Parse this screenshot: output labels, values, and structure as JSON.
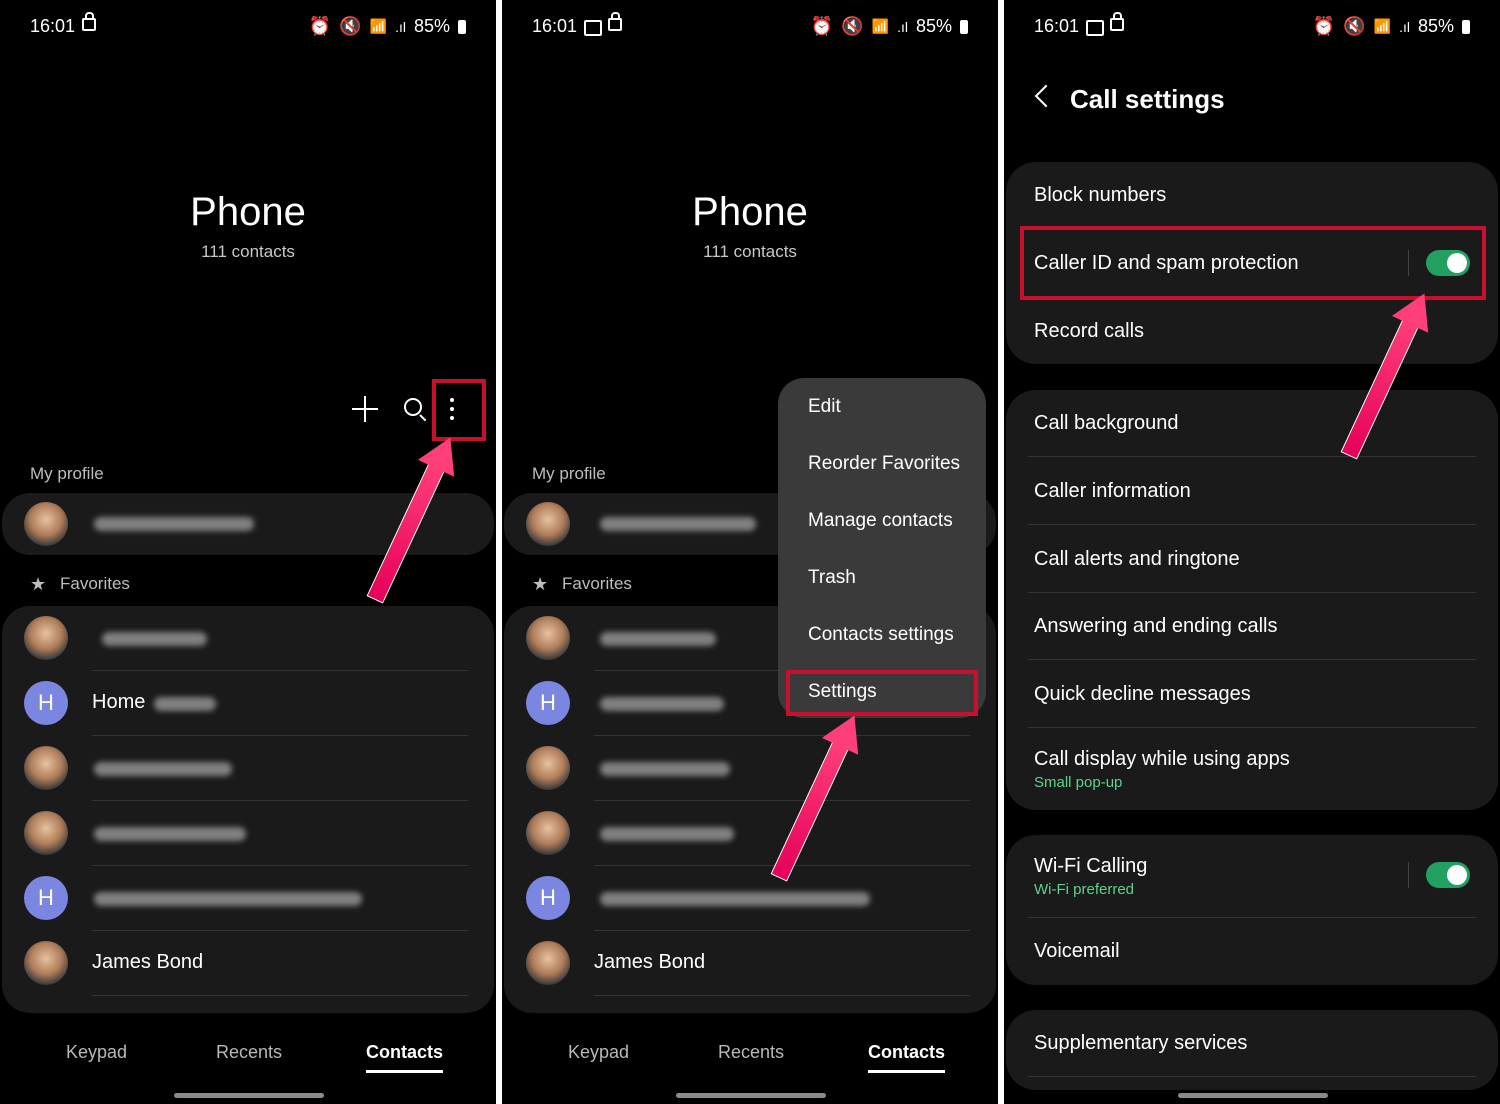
{
  "status": {
    "time": "16:01",
    "battery": "85%",
    "volte": "Vo))",
    "wifi_label": "WiFi2",
    "signal": ".ıl"
  },
  "phone": {
    "title": "Phone",
    "count": "111 contacts",
    "my_profile": "My profile",
    "favorites": "Favorites"
  },
  "contacts": {
    "home_initial": "H",
    "home_label": "Home",
    "james_bond": "James Bond",
    "h_initial": "H"
  },
  "nav": {
    "keypad": "Keypad",
    "recents": "Recents",
    "contacts": "Contacts"
  },
  "menu": {
    "items": [
      "Edit",
      "Reorder Favorites",
      "Manage contacts",
      "Trash",
      "Contacts settings",
      "Settings"
    ]
  },
  "call_settings": {
    "title": "Call settings",
    "block_numbers": "Block numbers",
    "caller_id": "Caller ID and spam protection",
    "caller_id_enabled": true,
    "record_calls": "Record calls",
    "call_background": "Call background",
    "caller_information": "Caller information",
    "call_alerts": "Call alerts and ringtone",
    "answering": "Answering and ending calls",
    "quick_decline": "Quick decline messages",
    "call_display": "Call display while using apps",
    "call_display_sub": "Small pop-up",
    "wifi_calling": "Wi-Fi Calling",
    "wifi_calling_sub": "Wi-Fi preferred",
    "wifi_calling_enabled": true,
    "voicemail": "Voicemail",
    "supplementary": "Supplementary services"
  },
  "colors": {
    "highlight": "#c8102e",
    "toggle_on": "#22a061",
    "accent_sub": "#5dd28b",
    "arrow": "#ff3f7a"
  }
}
